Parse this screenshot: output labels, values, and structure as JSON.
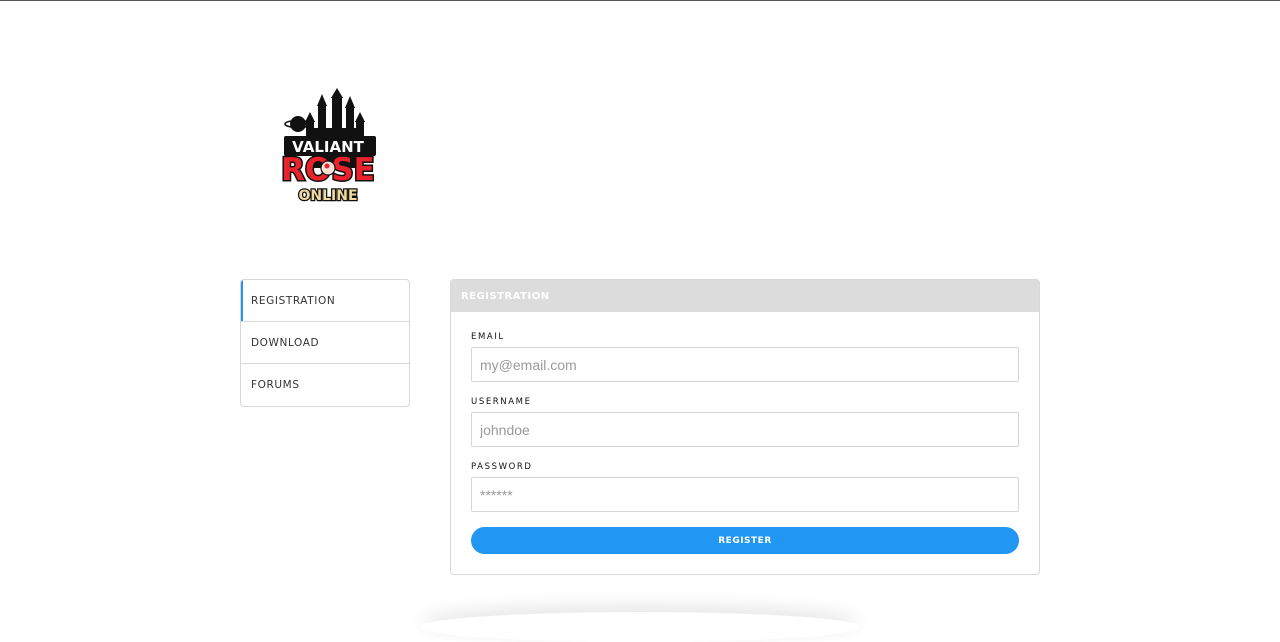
{
  "logo": {
    "icon": "valiant-rose-online-logo",
    "line1": "VALIANT",
    "line2": "ROSE",
    "line3": "ONLINE"
  },
  "sidebar": {
    "items": [
      {
        "label": "REGISTRATION",
        "active": true
      },
      {
        "label": "DOWNLOAD",
        "active": false
      },
      {
        "label": "FORUMS",
        "active": false
      }
    ]
  },
  "panel": {
    "title": "REGISTRATION",
    "fields": [
      {
        "label": "EMAIL",
        "placeholder": "my@email.com",
        "value": ""
      },
      {
        "label": "USERNAME",
        "placeholder": "johndoe",
        "value": ""
      },
      {
        "label": "PASSWORD",
        "placeholder": "******",
        "value": ""
      }
    ],
    "submit_label": "REGISTER"
  },
  "colors": {
    "accent": "#2196f3",
    "panel_header_bg": "#dcdcdc",
    "border": "#d8d8d8"
  }
}
